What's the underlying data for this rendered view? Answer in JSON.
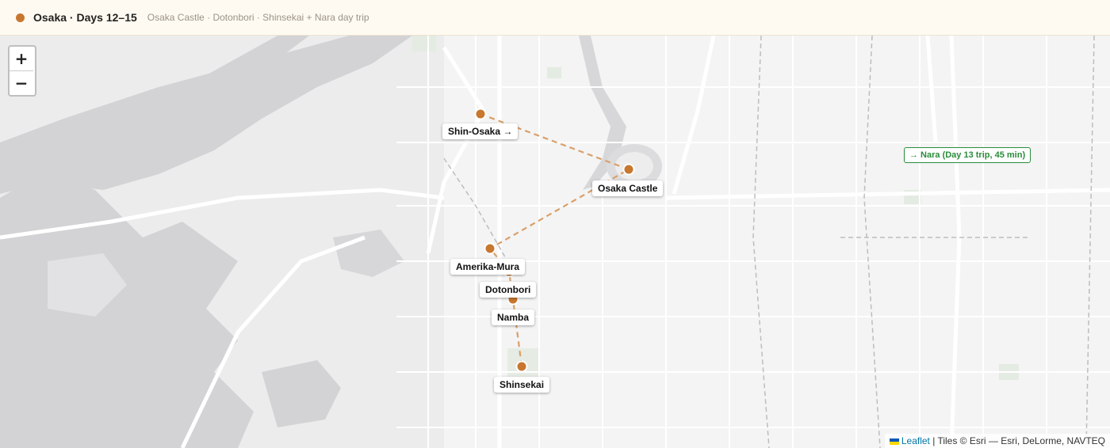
{
  "header": {
    "title": "Osaka · Days 12–15",
    "subtitle": "Osaka Castle · Dotonbori · Shinsekai + Nara day trip",
    "accent": "#c8772f"
  },
  "zoom": {
    "in": "+",
    "out": "−"
  },
  "stops": [
    {
      "name": "Shin-Osaka →"
    },
    {
      "name": "Osaka Castle"
    },
    {
      "name": "Amerika-Mura"
    },
    {
      "name": "Dotonbori"
    },
    {
      "name": "Namba"
    },
    {
      "name": "Shinsekai"
    }
  ],
  "nara_label": "→ Nara (Day 13 trip, 45 min)",
  "attribution": {
    "leaflet": "Leaflet",
    "tiles": "| Tiles © Esri — Esri, DeLorme, NAVTEQ"
  },
  "colors": {
    "route": "#d9a06a",
    "marker": "#c8772f",
    "nara": "#2a8c3a"
  }
}
